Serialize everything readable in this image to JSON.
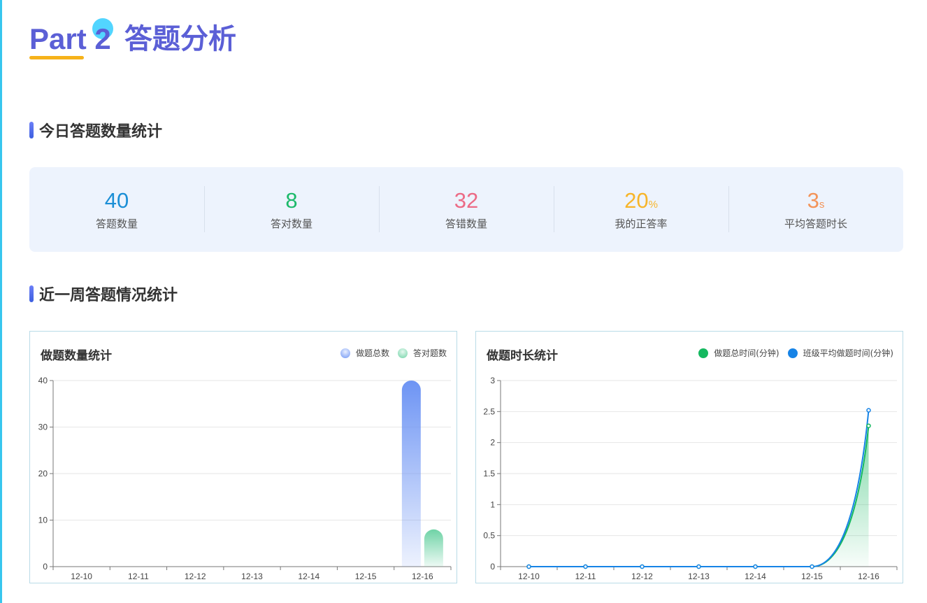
{
  "header": {
    "part_label": "Part 2",
    "section_name": "答题分析"
  },
  "today": {
    "title": "今日答题数量统计",
    "stats": [
      {
        "value": "40",
        "unit": "",
        "label": "答题数量",
        "color": "#1c8fd6"
      },
      {
        "value": "8",
        "unit": "",
        "label": "答对数量",
        "color": "#1cb96a"
      },
      {
        "value": "32",
        "unit": "",
        "label": "答错数量",
        "color": "#ec6b86"
      },
      {
        "value": "20",
        "unit": "%",
        "label": "我的正答率",
        "color": "#f7b52a"
      },
      {
        "value": "3",
        "unit": "s",
        "label": "平均答题时长",
        "color": "#f3945a"
      }
    ]
  },
  "week": {
    "title": "近一周答题情况统计"
  },
  "chart_data": [
    {
      "type": "bar",
      "title": "做题数量统计",
      "categories": [
        "12-10",
        "12-11",
        "12-12",
        "12-13",
        "12-14",
        "12-15",
        "12-16"
      ],
      "series": [
        {
          "name": "做题总数",
          "values": [
            0,
            0,
            0,
            0,
            0,
            0,
            40
          ],
          "color": "#6d94f4"
        },
        {
          "name": "答对题数",
          "values": [
            0,
            0,
            0,
            0,
            0,
            0,
            8
          ],
          "color": "#6fd3a6"
        }
      ],
      "yticks": [
        "0",
        "10",
        "20",
        "30",
        "40"
      ],
      "ylim": [
        0,
        40
      ],
      "grid": true,
      "legend": "top-right"
    },
    {
      "type": "line",
      "title": "做题时长统计",
      "categories": [
        "12-10",
        "12-11",
        "12-12",
        "12-13",
        "12-14",
        "12-15",
        "12-16"
      ],
      "series": [
        {
          "name": "做题总时间(分钟)",
          "values": [
            0,
            0,
            0,
            0,
            0,
            0,
            2.27
          ],
          "color": "#14b85f"
        },
        {
          "name": "班级平均做题时间(分钟)",
          "values": [
            0,
            0,
            0,
            0,
            0,
            0,
            2.52
          ],
          "color": "#1683e6"
        }
      ],
      "yticks": [
        "0",
        "0.5",
        "1",
        "1.5",
        "2",
        "2.5",
        "3"
      ],
      "ylim": [
        0,
        3
      ],
      "grid": true,
      "legend": "top-right"
    }
  ]
}
